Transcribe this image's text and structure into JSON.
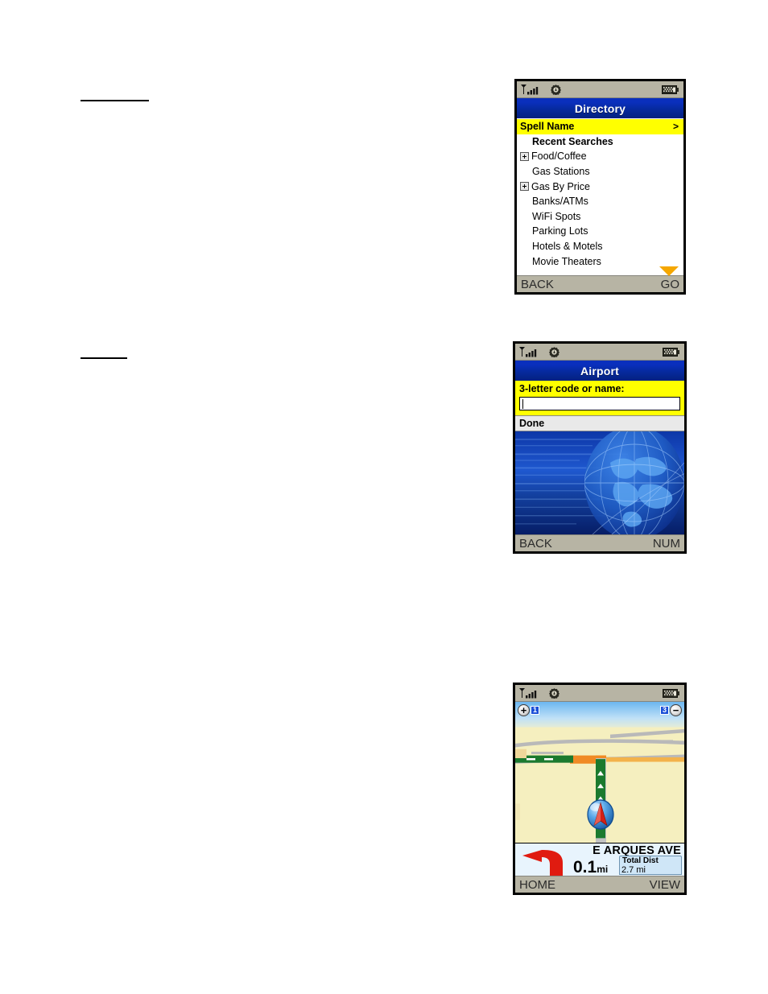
{
  "page": {
    "rules": [
      {
        "name": "heading-rule-top"
      },
      {
        "name": "heading-rule-middle"
      }
    ]
  },
  "devices": [
    {
      "id": "directory",
      "status_bar": {
        "signal_icon": "signal-antenna-icon",
        "settings_icon": "gear-icon",
        "battery_icon": "battery-icon"
      },
      "title": "Directory",
      "list": [
        {
          "label": "Spell Name",
          "selected": true,
          "bold": true,
          "expandable": false,
          "chevron": ">"
        },
        {
          "label": "Recent Searches",
          "selected": false,
          "bold": true,
          "expandable": false
        },
        {
          "label": "Food/Coffee",
          "selected": false,
          "bold": false,
          "expandable": true
        },
        {
          "label": "Gas Stations",
          "selected": false,
          "bold": false,
          "expandable": false
        },
        {
          "label": "Gas By Price",
          "selected": false,
          "bold": false,
          "expandable": true
        },
        {
          "label": "Banks/ATMs",
          "selected": false,
          "bold": false,
          "expandable": false
        },
        {
          "label": "WiFi Spots",
          "selected": false,
          "bold": false,
          "expandable": false
        },
        {
          "label": "Parking Lots",
          "selected": false,
          "bold": false,
          "expandable": false
        },
        {
          "label": "Hotels & Motels",
          "selected": false,
          "bold": false,
          "expandable": false
        },
        {
          "label": "Movie Theaters",
          "selected": false,
          "bold": false,
          "expandable": false
        }
      ],
      "scroll_indicator": "scroll-down-arrow",
      "soft_keys": {
        "left": "BACK",
        "right": "GO"
      }
    },
    {
      "id": "airport",
      "status_bar": {
        "signal_icon": "signal-antenna-icon",
        "settings_icon": "gear-icon",
        "battery_icon": "battery-icon"
      },
      "title": "Airport",
      "form": {
        "label": "3-letter code or name:",
        "input_value": "",
        "input_placeholder": ""
      },
      "done_label": "Done",
      "illustration": "globe-graphic",
      "soft_keys": {
        "left": "BACK",
        "right": "NUM"
      }
    },
    {
      "id": "navigation-map",
      "status_bar": {
        "signal_icon": "signal-antenna-icon",
        "settings_icon": "gear-icon",
        "battery_icon": "battery-icon"
      },
      "zoom_in_label": "+",
      "zoom_in_level": "1",
      "zoom_out_label": "−",
      "zoom_out_level": "3",
      "guidance": {
        "turn_icon": "turn-left-arrow-icon",
        "street_name": "E ARQUES AVE",
        "distance_value": "0.1",
        "distance_unit": "mi",
        "total_dist_label": "Total Dist",
        "total_dist_value": "2.7 mi"
      },
      "soft_keys": {
        "left": "HOME",
        "right": "VIEW"
      }
    }
  ],
  "colors": {
    "title_blue": "#0a2fbd",
    "highlight_yellow": "#ffff00",
    "status_gray": "#b7b4a4",
    "route_green": "#1b7a2e",
    "road_orange": "#f0a43a",
    "turn_red": "#e01b10"
  }
}
